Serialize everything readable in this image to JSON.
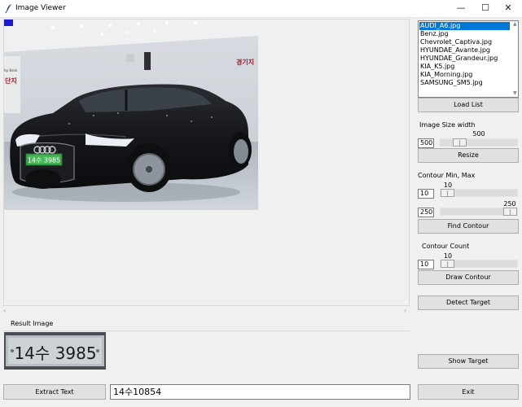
{
  "window": {
    "title": "Image Viewer",
    "minimize": "—",
    "maximize": "☐",
    "close": "✕"
  },
  "files": {
    "items": [
      "AUDI_A6.jpg",
      "Benz.jpg",
      "Chevrolet_Captiva.jpg",
      "HYUNDAE_Avante.jpg",
      "HYUNDAE_Grandeur.jpg",
      "KIA_K5.jpg",
      "KIA_Morning.jpg",
      "SAMSUNG_SM5.jpg"
    ],
    "selected": "AUDI_A6.jpg"
  },
  "load_list_label": "Load List",
  "image_size": {
    "label": "Image Size width",
    "value": "500",
    "scale_value": "500",
    "fraction": 0.2,
    "button": "Resize"
  },
  "contour": {
    "label": "Contour Min, Max",
    "min_value": "10",
    "min_scale": "10",
    "min_fraction": 0.0,
    "max_value": "250",
    "max_scale": "250",
    "max_fraction": 1.0,
    "button": "Find Contour"
  },
  "contour_count": {
    "label": "Contour Count",
    "value": "10",
    "scale_value": "10",
    "fraction": 0.0,
    "button": "Draw Contour"
  },
  "detect_target_label": "Detect Target",
  "show_target_label": "Show Target",
  "exit_label": "Exit",
  "result": {
    "label": "Result Image",
    "extract_label": "Extract Text",
    "text": "14수10854",
    "plate_text": "14수 3985"
  },
  "photo": {
    "plate_text": "14수 3985",
    "banner_right": "경기지",
    "banner_left": "단지"
  },
  "scroll": {
    "left": "‹",
    "right": "›",
    "up": "▲",
    "down": "▼"
  }
}
